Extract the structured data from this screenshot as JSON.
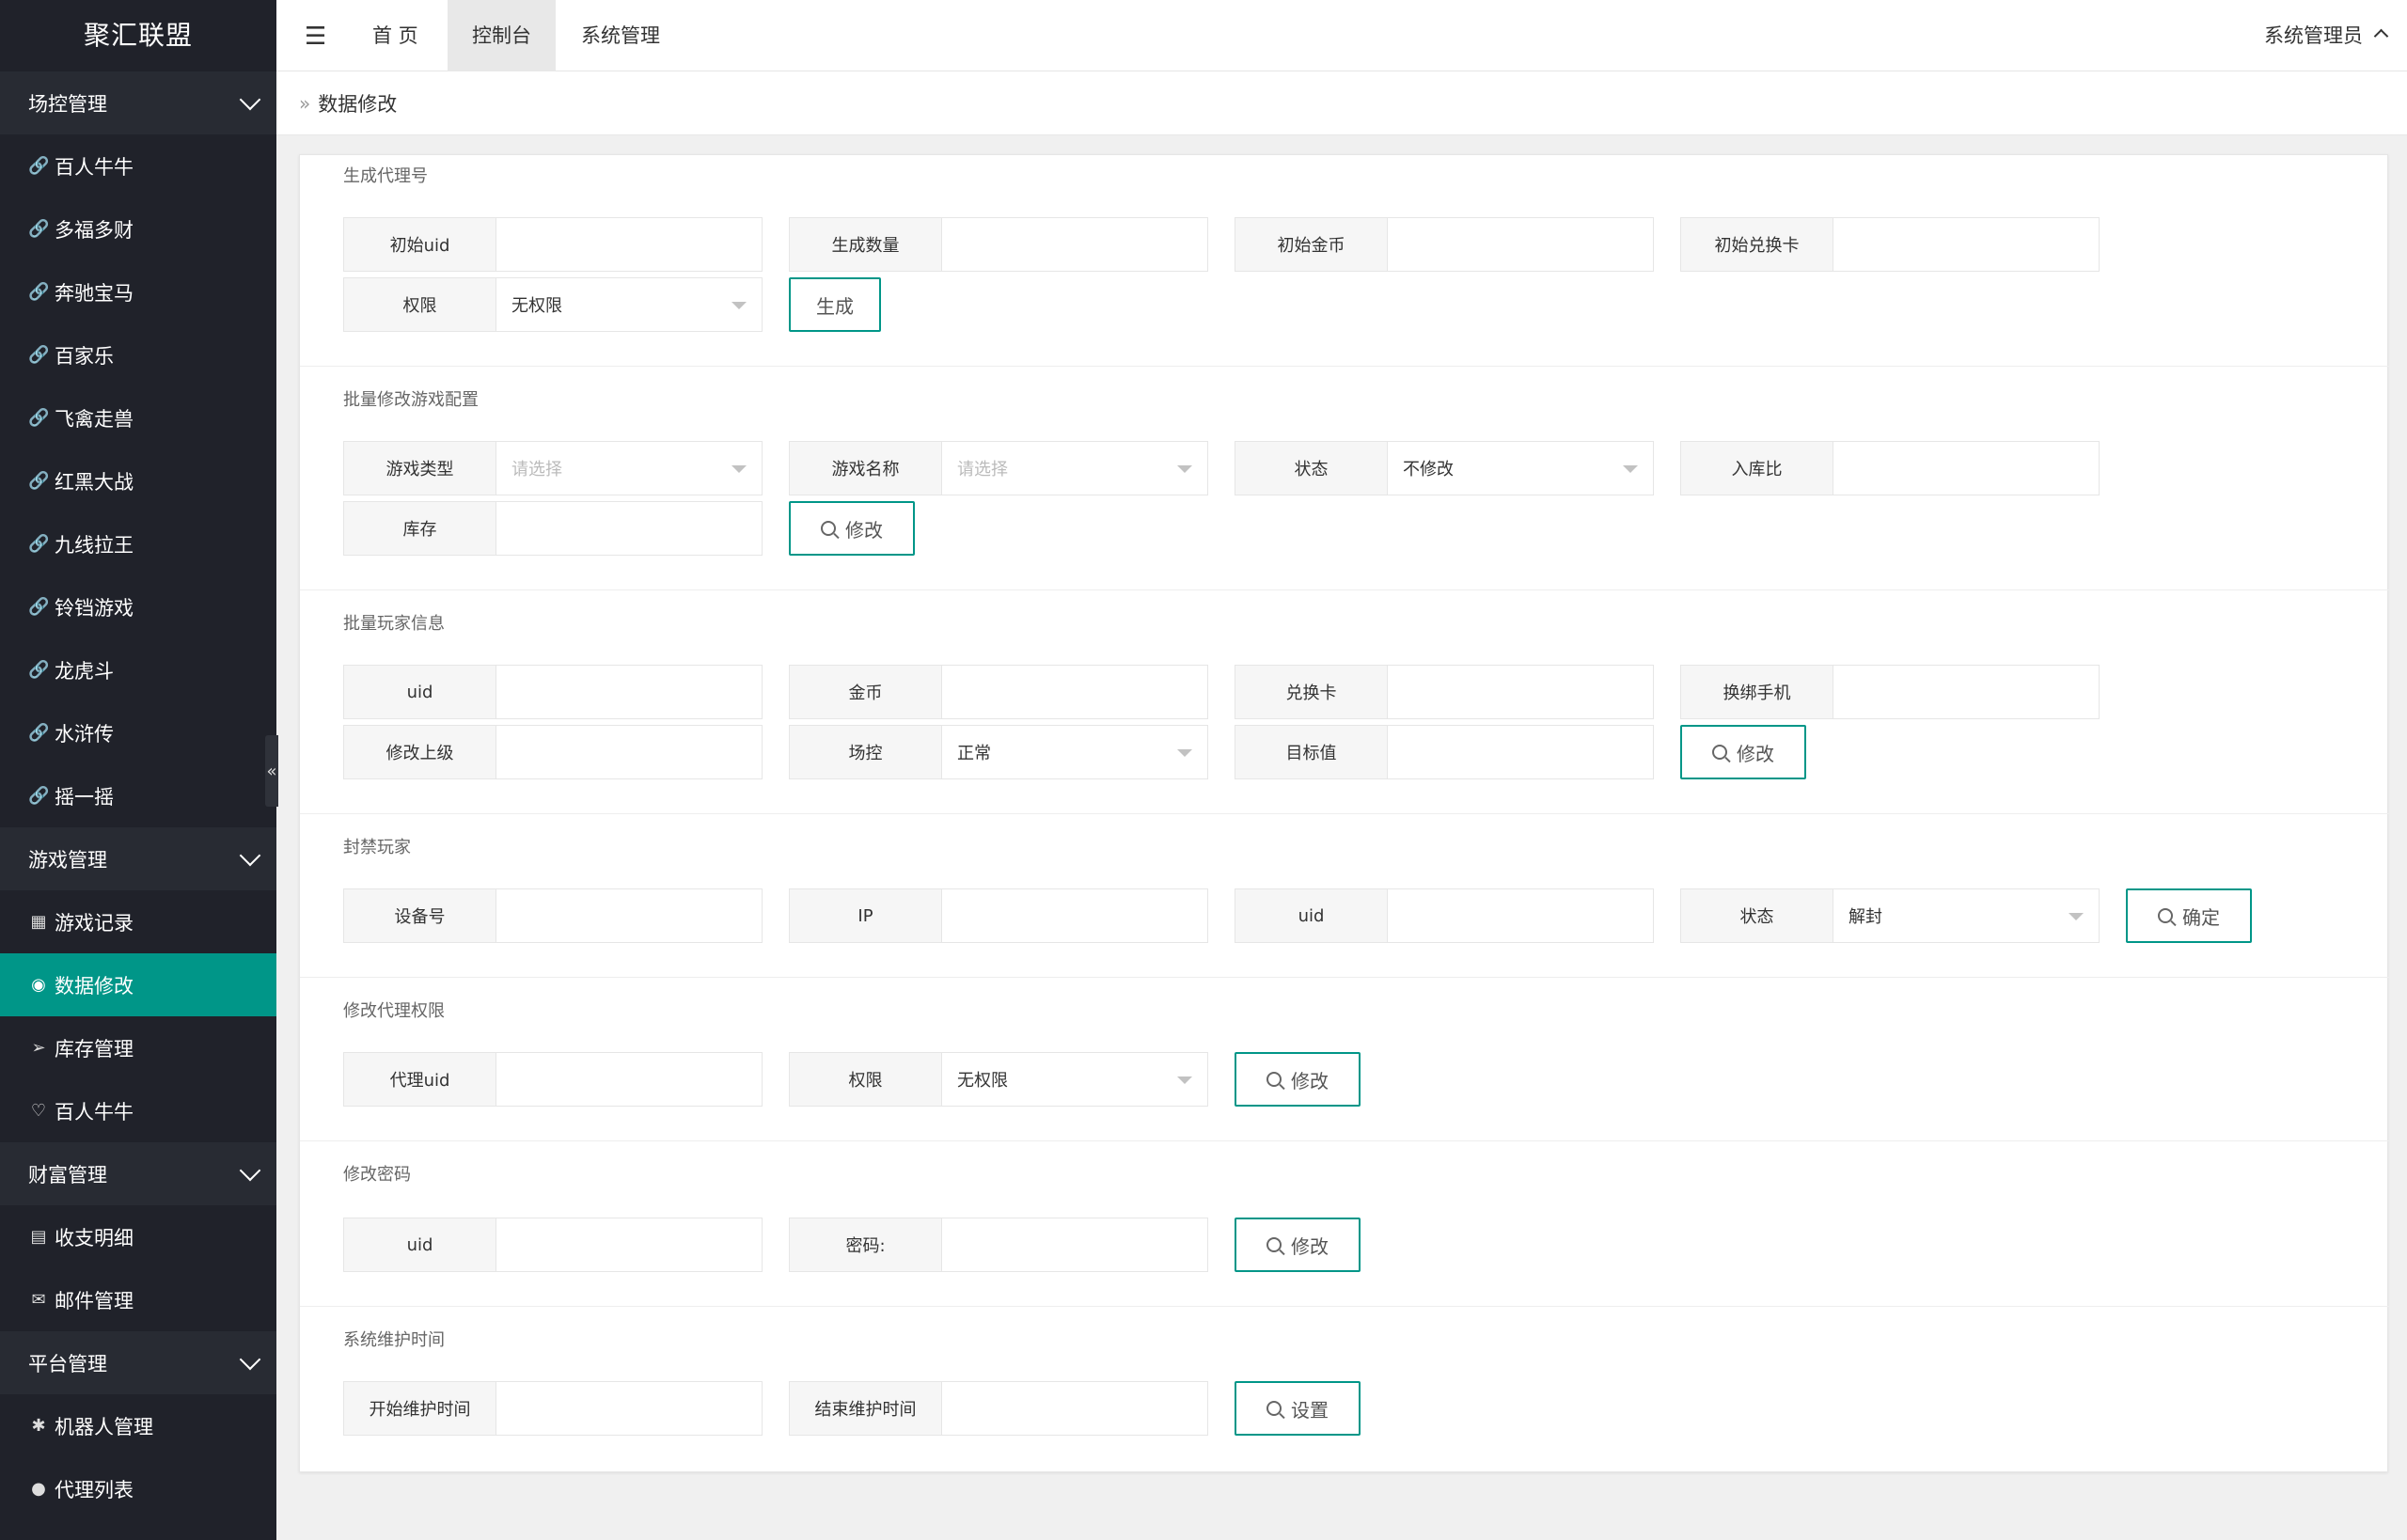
{
  "app": {
    "logo": "聚汇联盟"
  },
  "header": {
    "tabs": [
      {
        "label": "首 页"
      },
      {
        "label": "控制台"
      },
      {
        "label": "系统管理"
      }
    ],
    "user": "系统管理员"
  },
  "breadcrumb": {
    "current": "数据修改"
  },
  "sidebar": {
    "groups": {
      "g1": "场控管理",
      "g2": "游戏管理",
      "g3": "财富管理",
      "g4": "平台管理"
    },
    "items": {
      "i1": "百人牛牛",
      "i2": "多福多财",
      "i3": "奔驰宝马",
      "i4": "百家乐",
      "i5": "飞禽走兽",
      "i6": "红黑大战",
      "i7": "九线拉王",
      "i8": "铃铛游戏",
      "i9": "龙虎斗",
      "i10": "水浒传",
      "i11": "摇一摇",
      "i12": "游戏记录",
      "i13": "数据修改",
      "i14": "库存管理",
      "i15": "百人牛牛",
      "i16": "收支明细",
      "i17": "邮件管理",
      "i18": "机器人管理",
      "i19": "代理列表"
    },
    "icons": {
      "link": "link-icon",
      "list": "list-icon",
      "broadcast": "broadcast-icon",
      "send": "send-icon",
      "heart": "heart-icon",
      "receipt": "receipt-icon",
      "mail": "mail-icon",
      "robot": "robot-icon",
      "user": "user-icon"
    },
    "accent": "#009688"
  },
  "sections": {
    "s1": {
      "title": "生成代理号",
      "f1": "初始uid",
      "f2": "生成数量",
      "f3": "初始金币",
      "f4": "初始兑换卡",
      "f5": "权限",
      "f5_value": "无权限",
      "button": "生成"
    },
    "s2": {
      "title": "批量修改游戏配置",
      "f1": "游戏类型",
      "f1_value": "请选择",
      "f2": "游戏名称",
      "f2_value": "请选择",
      "f3": "状态",
      "f3_value": "不修改",
      "f4": "入库比",
      "f5": "库存",
      "button": "修改"
    },
    "s3": {
      "title": "批量玩家信息",
      "f1": "uid",
      "f2": "金币",
      "f3": "兑换卡",
      "f4": "换绑手机",
      "f5": "修改上级",
      "f6": "场控",
      "f6_value": "正常",
      "f7": "目标值",
      "button": "修改"
    },
    "s4": {
      "title": "封禁玩家",
      "f1": "设备号",
      "f2": "IP",
      "f3": "uid",
      "f4": "状态",
      "f4_value": "解封",
      "button": "确定"
    },
    "s5": {
      "title": "修改代理权限",
      "f1": "代理uid",
      "f2": "权限",
      "f2_value": "无权限",
      "button": "修改"
    },
    "s6": {
      "title": "修改密码",
      "f1": "uid",
      "f2": "密码:",
      "button": "修改"
    },
    "s7": {
      "title": "系统维护时间",
      "f1": "开始维护时间",
      "f2": "结束维护时间",
      "button": "设置"
    }
  }
}
